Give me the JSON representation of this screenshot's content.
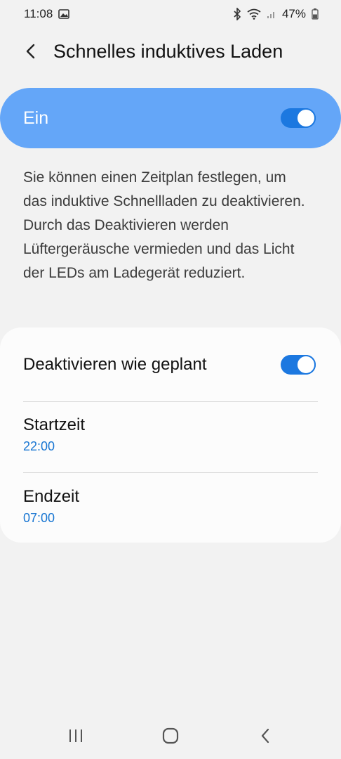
{
  "status_bar": {
    "time": "11:08",
    "battery": "47%",
    "icons": [
      "image-icon",
      "bluetooth-icon",
      "wifi-icon",
      "signal-icon",
      "battery-icon"
    ]
  },
  "header": {
    "title": "Schnelles induktives Laden",
    "back_icon": "back-arrow-icon"
  },
  "master_switch": {
    "label": "Ein",
    "state": "on"
  },
  "description": "Sie können einen Zeitplan festlegen, um das induktive Schnellladen zu deaktivieren. Durch das Deaktivieren werden Lüftergeräusche vermieden und das Licht der LEDs am Ladegerät reduziert.",
  "settings": {
    "schedule_label": "Deaktivieren wie geplant",
    "schedule_state": "on",
    "start_label": "Startzeit",
    "start_value": "22:00",
    "end_label": "Endzeit",
    "end_value": "07:00"
  },
  "nav_bar": {
    "icons": [
      "recent-apps-icon",
      "home-icon",
      "back-icon"
    ]
  },
  "colors": {
    "accent": "#1c78e0",
    "master_bg": "#64a6f8",
    "value_text": "#1976d2",
    "background": "#f2f2f2"
  }
}
